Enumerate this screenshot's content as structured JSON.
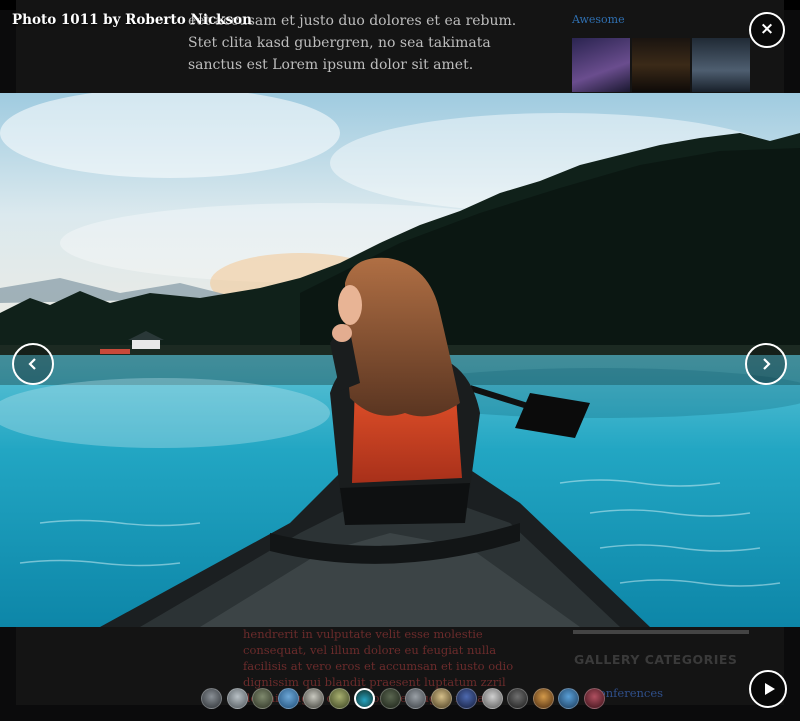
{
  "background_page": {
    "article_text": "eet accusam et justo duo dolores et ea rebum. Stet clita kasd gubergren, no sea takimata sanctus est Lorem ipsum dolor sit amet.",
    "article_bottom_text": "hendrerit in vulputate velit esse molestie consequat, vel illum dolore eu feugiat nulla facilisis at vero eros et accumsan et iusto odio dignissim qui blandit praesent luptatum zzril delenit augue duis dolore te feugait nulla",
    "sidebar_link": "Awesome",
    "gallery_categories_heading": "GALLERY CATEGORIES",
    "category_link": "Conferences"
  },
  "lightbox": {
    "caption": "Photo 1011 by Roberto Nickson",
    "close_label": "×",
    "active_index": 6,
    "thumbnail_count": 16
  },
  "colors": {
    "lake": "#1fa7c4",
    "sky": "#cfe3ec",
    "forest": "#0e1e18",
    "life_vest": "#d2401f",
    "hair": "#8a5232"
  },
  "icons": {
    "close": "close-icon",
    "prev": "chevron-left-icon",
    "next": "chevron-right-icon",
    "play": "play-icon"
  }
}
